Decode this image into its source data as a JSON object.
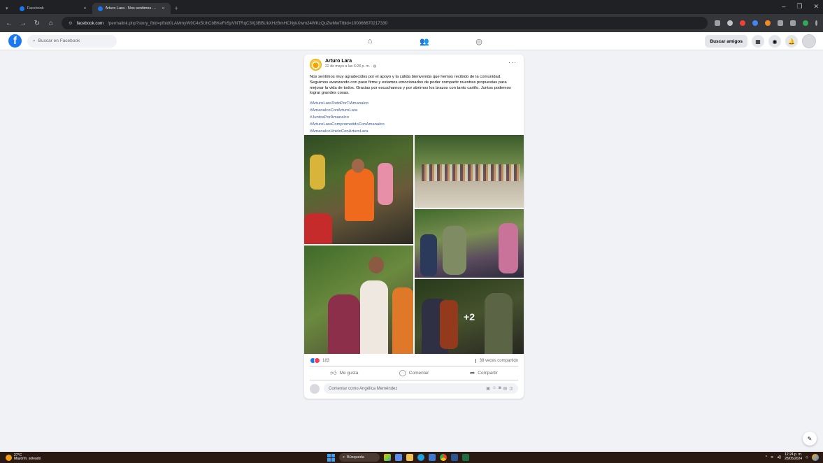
{
  "browser": {
    "tabs": [
      {
        "title": "Facebook",
        "active": false
      },
      {
        "title": "Arturo Lara - Nos sentimos mu...",
        "active": true
      }
    ],
    "url_host": "facebook.com",
    "url_path": "/permalink.php?story_fbid=pfbid0LAMmyW9C4x5UhCbBKeFn5pVNTRqC3Xj3BBUkXHzBmHCNykXwm24WKzQuZwMwTtbid=100066670217330"
  },
  "facebook": {
    "search_placeholder": "Buscar en Facebook",
    "find_friends": "Buscar amigos",
    "brand_color": "#1877f2"
  },
  "post": {
    "author": "Arturo Lara",
    "date": "22 de mayo a las 6:28 p. m. ·",
    "text": "Nos sentimos muy agradecidos por el apoyo y la cálida bienvenida que hemos recibido de la comunidad. Seguimos avanzando con paso firme y estamos emocionados de poder compartir nuestras propuestas para mejorar la vida de todos. Gracias por escucharnos y por abrirnos los brazos con tanto cariño. Juntos podemos lograr grandes cosas.",
    "hashtags": [
      "#ArturoLaraTodoPorTiAmanalco",
      "#AmanalcoConArturoLara",
      "#JuntosPorAmanalco",
      "#ArturoLaraComprometidoConAmanalco",
      "#AmanalcoUnidoConArturoLara"
    ],
    "more_photos": "+2",
    "reactions_count": "183",
    "shares": "38 veces compartido",
    "actions": {
      "like": "Me gusta",
      "comment": "Comentar",
      "share": "Compartir"
    },
    "comment_placeholder": "Comentar como Angélica Meméndez"
  },
  "taskbar": {
    "temperature": "27°C",
    "weather": "Mayorm. soleado",
    "search": "Búsqueda",
    "time": "12:24 p. m.",
    "date": "28/05/2024"
  }
}
